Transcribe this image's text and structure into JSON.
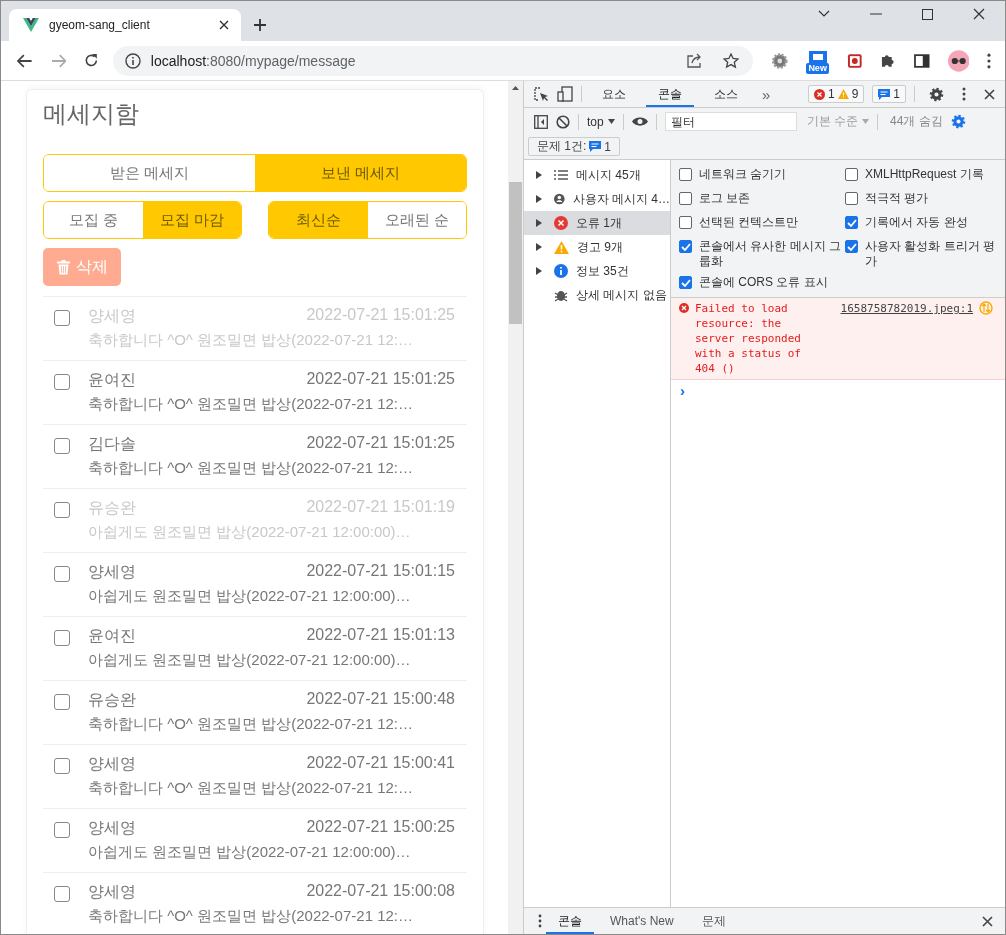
{
  "browser": {
    "tab_title": "gyeom-sang_client",
    "url_host": "localhost",
    "url_path": ":8080/mypage/message",
    "extension_badge": "New"
  },
  "page": {
    "title": "메세지함",
    "box_tabs": [
      {
        "label": "받은 메세지",
        "selected": false
      },
      {
        "label": "보낸 메세지",
        "selected": true
      }
    ],
    "status_filter": [
      {
        "label": "모집 중",
        "selected": false
      },
      {
        "label": "모집 마감",
        "selected": true
      }
    ],
    "sort": [
      {
        "label": "최신순",
        "selected": true
      },
      {
        "label": "오래된 순",
        "selected": false
      }
    ],
    "delete_button": "삭제",
    "messages": [
      {
        "sender": "양세영",
        "time": "2022-07-21 15:01:25",
        "preview": "축하합니다 ^O^ 원조밀면 밥상(2022-07-21 12:…",
        "read": true,
        "checked": false
      },
      {
        "sender": "윤여진",
        "time": "2022-07-21 15:01:25",
        "preview": "축하합니다 ^O^ 원조밀면 밥상(2022-07-21 12:…",
        "read": false,
        "checked": false
      },
      {
        "sender": "김다솔",
        "time": "2022-07-21 15:01:25",
        "preview": "축하합니다 ^O^ 원조밀면 밥상(2022-07-21 12:…",
        "read": false,
        "checked": false
      },
      {
        "sender": "유승완",
        "time": "2022-07-21 15:01:19",
        "preview": "아쉽게도 원조밀면 밥상(2022-07-21 12:00:00)…",
        "read": true,
        "checked": false
      },
      {
        "sender": "양세영",
        "time": "2022-07-21 15:01:15",
        "preview": "아쉽게도 원조밀면 밥상(2022-07-21 12:00:00)…",
        "read": false,
        "checked": false
      },
      {
        "sender": "윤여진",
        "time": "2022-07-21 15:01:13",
        "preview": "아쉽게도 원조밀면 밥상(2022-07-21 12:00:00)…",
        "read": false,
        "checked": false
      },
      {
        "sender": "유승완",
        "time": "2022-07-21 15:00:48",
        "preview": "축하합니다 ^O^ 원조밀면 밥상(2022-07-21 12:…",
        "read": false,
        "checked": false
      },
      {
        "sender": "양세영",
        "time": "2022-07-21 15:00:41",
        "preview": "축하합니다 ^O^ 원조밀면 밥상(2022-07-21 12:…",
        "read": false,
        "checked": false
      },
      {
        "sender": "양세영",
        "time": "2022-07-21 15:00:25",
        "preview": "아쉽게도 원조밀면 밥상(2022-07-21 12:00:00)…",
        "read": false,
        "checked": false
      },
      {
        "sender": "양세영",
        "time": "2022-07-21 15:00:08",
        "preview": "축하합니다 ^O^ 원조밀면 밥상(2022-07-21 12:…",
        "read": false,
        "checked": false
      }
    ]
  },
  "devtools": {
    "tabs": [
      {
        "label": "요소",
        "selected": false
      },
      {
        "label": "콘솔",
        "selected": true
      },
      {
        "label": "소스",
        "selected": false
      }
    ],
    "more": "»",
    "error_count": "1",
    "warning_count": "9",
    "info_count": "1",
    "context": "top",
    "filter_placeholder": "필터",
    "levels": "기본 수준",
    "hidden_count": "44개 숨김",
    "issues_label": "문제 1건:",
    "issues_count": "1",
    "sidebar": [
      {
        "label": "메시지 45개",
        "kind": "list",
        "selected": false
      },
      {
        "label": "사용자 메시지 4…",
        "kind": "user",
        "selected": false
      },
      {
        "label": "오류 1개",
        "kind": "error",
        "selected": true
      },
      {
        "label": "경고 9개",
        "kind": "warning",
        "selected": false
      },
      {
        "label": "정보 35건",
        "kind": "info",
        "selected": false
      },
      {
        "label": "상세 메시지 없음",
        "kind": "verbose",
        "selected": false
      }
    ],
    "settings": [
      {
        "label": "네트워크 숨기기",
        "checked": false
      },
      {
        "label": "XMLHttpRequest 기록",
        "checked": false
      },
      {
        "label": "로그 보존",
        "checked": false
      },
      {
        "label": "적극적 평가",
        "checked": false
      },
      {
        "label": "선택된 컨텍스트만",
        "checked": false
      },
      {
        "label": "기록에서 자동 완성",
        "checked": true
      },
      {
        "label": "콘솔에서 유사한 메시지 그룹화",
        "checked": true
      },
      {
        "label": "사용자 활성화 트리거 평가",
        "checked": true
      },
      {
        "label": "콘솔에 CORS 오류 표시",
        "checked": true
      }
    ],
    "console": [
      {
        "kind": "error",
        "text": "Failed to load resource: the server responded with a status of 404 ()",
        "source": "1658758782019.jpeg:1"
      }
    ],
    "prompt": "›",
    "drawer_tabs": [
      {
        "label": "콘솔",
        "selected": true
      },
      {
        "label": "What's New",
        "selected": false
      },
      {
        "label": "문제",
        "selected": false
      }
    ]
  }
}
